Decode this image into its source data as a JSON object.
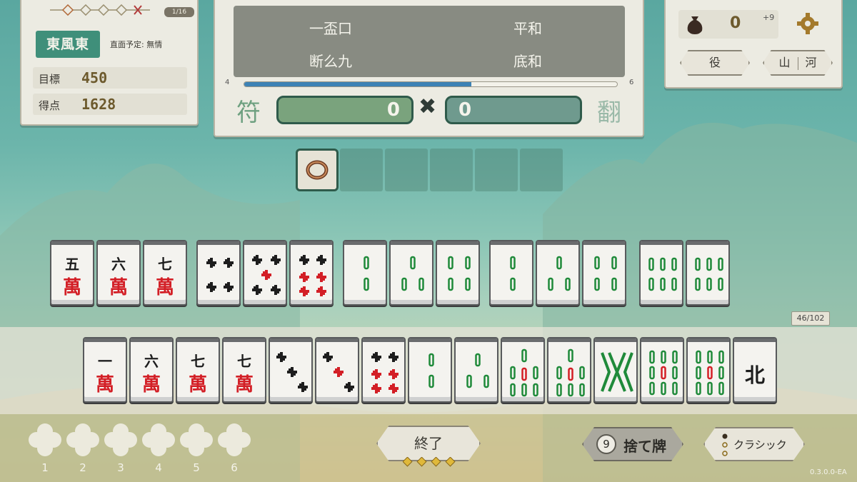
{
  "info": {
    "round_progress": "1/16",
    "wind": "東風東",
    "dora_text": "直面予定: 無情",
    "target_label": "目標",
    "target_value": "450",
    "score_label": "得点",
    "score_value": "1628"
  },
  "yaku_panel": {
    "yaku": [
      "一盃口",
      "平和",
      "断么九",
      "底和"
    ],
    "progress_min": "4",
    "progress_max": "6",
    "progress_fraction": 0.61,
    "fu_label": "符",
    "han_label": "翻",
    "fu_value": "0",
    "han_value": "0",
    "times_symbol": "✖"
  },
  "top_right": {
    "coins": "0",
    "coin_bonus": "+9",
    "yaku_button": "役",
    "river_left": "山",
    "river_right": "河"
  },
  "joker_slots": {
    "count": 6,
    "filled": 1,
    "filled_icon": "ring-icon"
  },
  "wall_count": "46/102",
  "played_tiles": [
    {
      "type": "man",
      "num": "五"
    },
    {
      "type": "man",
      "num": "六"
    },
    {
      "type": "man",
      "num": "七"
    },
    {
      "type": "pin",
      "n": 4
    },
    {
      "type": "pin",
      "n": 5
    },
    {
      "type": "pin",
      "n": 6
    },
    {
      "type": "sou",
      "n": 2
    },
    {
      "type": "sou",
      "n": 3
    },
    {
      "type": "sou",
      "n": 4
    },
    {
      "type": "sou",
      "n": 2
    },
    {
      "type": "sou",
      "n": 3
    },
    {
      "type": "sou",
      "n": 4
    },
    {
      "type": "sou",
      "n": 6
    },
    {
      "type": "sou",
      "n": 6
    }
  ],
  "hand_tiles": [
    {
      "type": "man",
      "num": "一"
    },
    {
      "type": "man",
      "num": "六"
    },
    {
      "type": "man",
      "num": "七"
    },
    {
      "type": "man",
      "num": "七"
    },
    {
      "type": "pin",
      "n": 3
    },
    {
      "type": "pin",
      "n": 3,
      "red": true
    },
    {
      "type": "pin",
      "n": 6
    },
    {
      "type": "sou",
      "n": 2
    },
    {
      "type": "sou",
      "n": 3
    },
    {
      "type": "sou",
      "n": 7
    },
    {
      "type": "sou",
      "n": 7
    },
    {
      "type": "sou",
      "n": 8
    },
    {
      "type": "sou",
      "n": 9
    },
    {
      "type": "sou",
      "n": 9
    },
    {
      "type": "honor",
      "char": "北"
    }
  ],
  "flowers": [
    "1",
    "2",
    "3",
    "4",
    "5",
    "6"
  ],
  "end_button": "終了",
  "discard": {
    "count": "9",
    "label": "捨て牌"
  },
  "classic_button": "クラシック",
  "version": "0.3.0.0-EA",
  "colors": {
    "man_red": "#d31f26",
    "sou_green": "#1f8a3a",
    "pin_black": "#1d1d1d",
    "panel": "#ecebe2",
    "accent_green": "#3f8f7a"
  }
}
